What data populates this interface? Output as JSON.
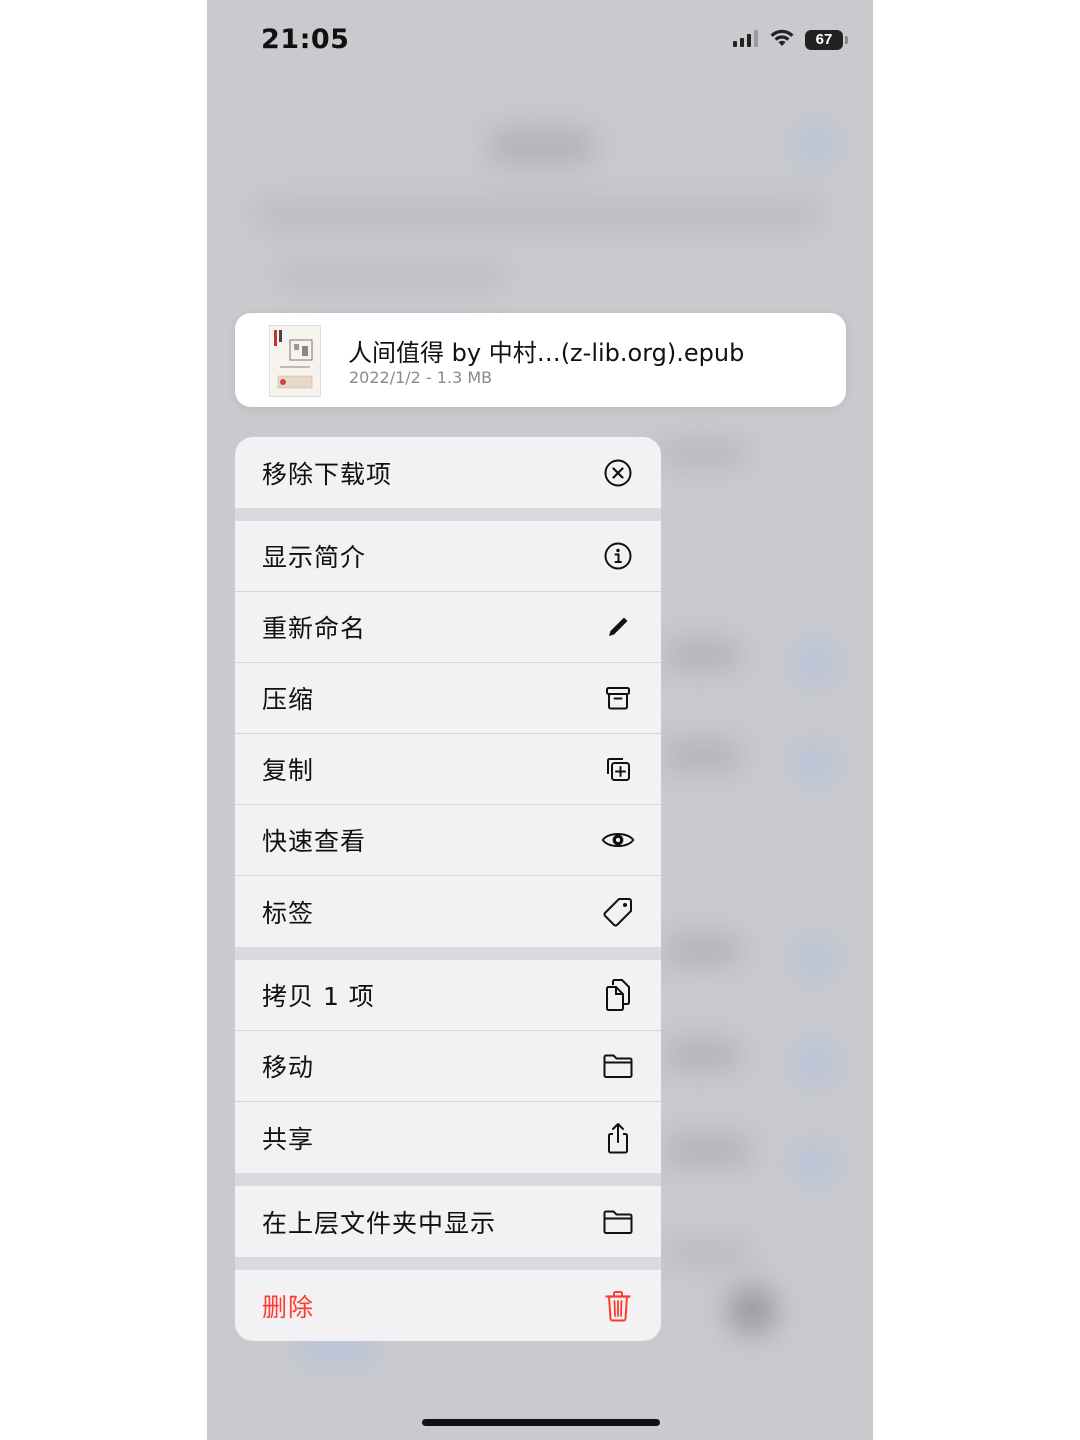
{
  "status_bar": {
    "time": "21:05",
    "battery": "67"
  },
  "file_card": {
    "name": "人间值得 by 中村…(z-lib.org).epub",
    "meta": "2022/1/2 - 1.3 MB"
  },
  "menu": {
    "groups": [
      [
        {
          "label": "移除下载项",
          "icon": "xmark-circle-icon"
        }
      ],
      [
        {
          "label": "显示简介",
          "icon": "info-circle-icon"
        },
        {
          "label": "重新命名",
          "icon": "pencil-icon"
        },
        {
          "label": "压缩",
          "icon": "archivebox-icon"
        },
        {
          "label": "复制",
          "icon": "duplicate-icon"
        },
        {
          "label": "快速查看",
          "icon": "eye-icon"
        },
        {
          "label": "标签",
          "icon": "tag-icon"
        }
      ],
      [
        {
          "label": "拷贝 1 项",
          "icon": "copy-doc-icon"
        },
        {
          "label": "移动",
          "icon": "folder-icon"
        },
        {
          "label": "共享",
          "icon": "share-icon"
        }
      ],
      [
        {
          "label": "在上层文件夹中显示",
          "icon": "folder-icon"
        }
      ],
      [
        {
          "label": "删除",
          "icon": "trash-icon"
        }
      ]
    ]
  },
  "colors": {
    "destructive": "#ff3b30",
    "text": "#111111",
    "secondary_text": "#8a8a8e"
  }
}
